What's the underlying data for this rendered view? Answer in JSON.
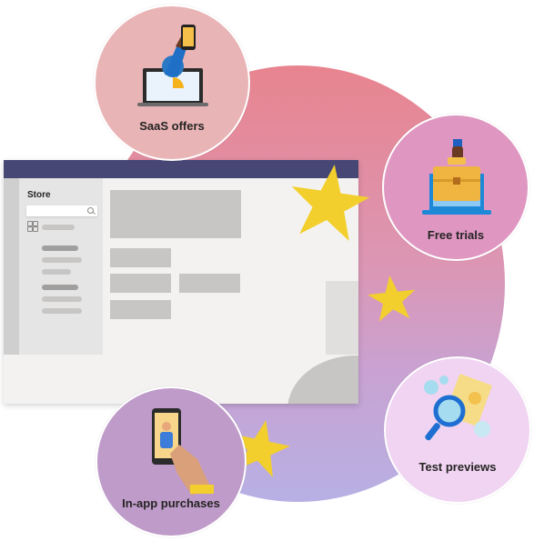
{
  "store_window": {
    "title": "Store",
    "search_placeholder": ""
  },
  "offers": [
    {
      "id": "saas",
      "label": "SaaS offers",
      "icon": "laptop-with-phone-icon",
      "color": "#e9b4b6"
    },
    {
      "id": "trials",
      "label": "Free trials",
      "icon": "briefcase-laptop-icon",
      "color": "#df97c2"
    },
    {
      "id": "previews",
      "label": "Test previews",
      "icon": "magnifier-document-icon",
      "color": "#f0d4f2"
    },
    {
      "id": "purchases",
      "label": "In-app purchases",
      "icon": "phone-in-hand-icon",
      "color": "#bf9bc9"
    }
  ],
  "colors": {
    "titlebar": "#464775",
    "star": "#f2cf2c",
    "blob_top": "#e8848f",
    "blob_bottom": "#b7b0e4"
  }
}
